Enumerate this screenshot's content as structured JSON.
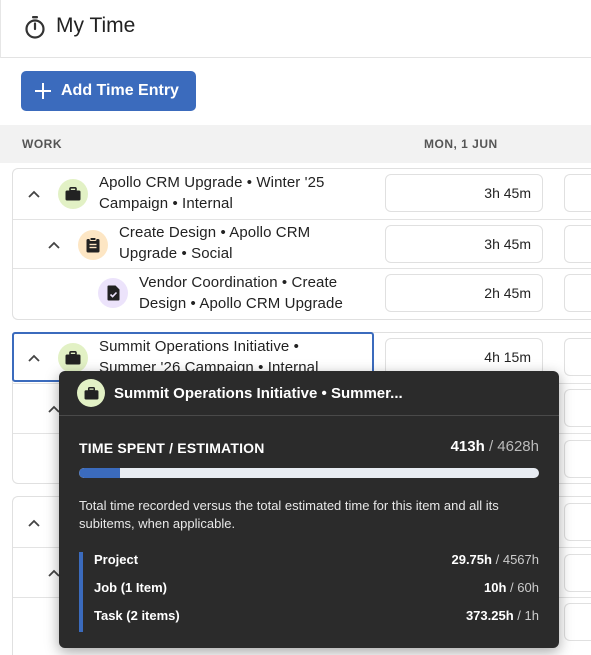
{
  "header": {
    "title": "My Time",
    "icon": "stopwatch-icon"
  },
  "toolbar": {
    "add_label": "Add Time Entry"
  },
  "columns": {
    "work": "WORK",
    "day": "MON, 1 JUN"
  },
  "rows": [
    {
      "label": "Apollo CRM Upgrade • Winter '25 Campaign • Internal",
      "line1": "Apollo CRM Upgrade • Winter '25",
      "line2": "Campaign • Internal",
      "icon": "briefcase-icon",
      "time": "3h 45m"
    },
    {
      "label": "Create Design • Apollo CRM Upgrade • Social",
      "line1": "Create Design • Apollo CRM",
      "line2": "Upgrade • Social",
      "icon": "clipboard-icon",
      "time": "3h 45m"
    },
    {
      "label": "Vendor Coordination • Create Design • Apollo CRM Upgrade",
      "line1": "Vendor Coordination • Create",
      "line2": "Design • Apollo CRM Upgrade",
      "icon": "task-doc-icon",
      "time": "2h 45m"
    },
    {
      "label": "Summit Operations Initiative • Summer '26 Campaign • Internal",
      "line1": "Summit Operations Initiative •",
      "line2": "Summer '26 Campaign • Internal",
      "icon": "briefcase-icon",
      "time": "4h 15m"
    }
  ],
  "tooltip": {
    "title": "Summit Operations Initiative • Summer...",
    "section": "TIME SPENT / ESTIMATION",
    "spent": "413h",
    "estimate": "4628h",
    "progress_fraction": 0.089,
    "description": "Total time recorded versus the total estimated time for this item and all its subitems, when applicable.",
    "breakdown": [
      {
        "label": "Project",
        "spent": "29.75h",
        "estimate": "4567h"
      },
      {
        "label": "Job (1 Item)",
        "spent": "10h",
        "estimate": "60h"
      },
      {
        "label": "Task (2 items)",
        "spent": "373.25h",
        "estimate": "1h"
      }
    ]
  },
  "colors": {
    "accent": "#3b6bbd",
    "tooltip_bg": "#2b2b2b",
    "job_icon_bg": "#e2f1c5",
    "project_icon_bg": "#fde6c4",
    "task_icon_bg": "#ece3fb"
  },
  "separator": "/"
}
